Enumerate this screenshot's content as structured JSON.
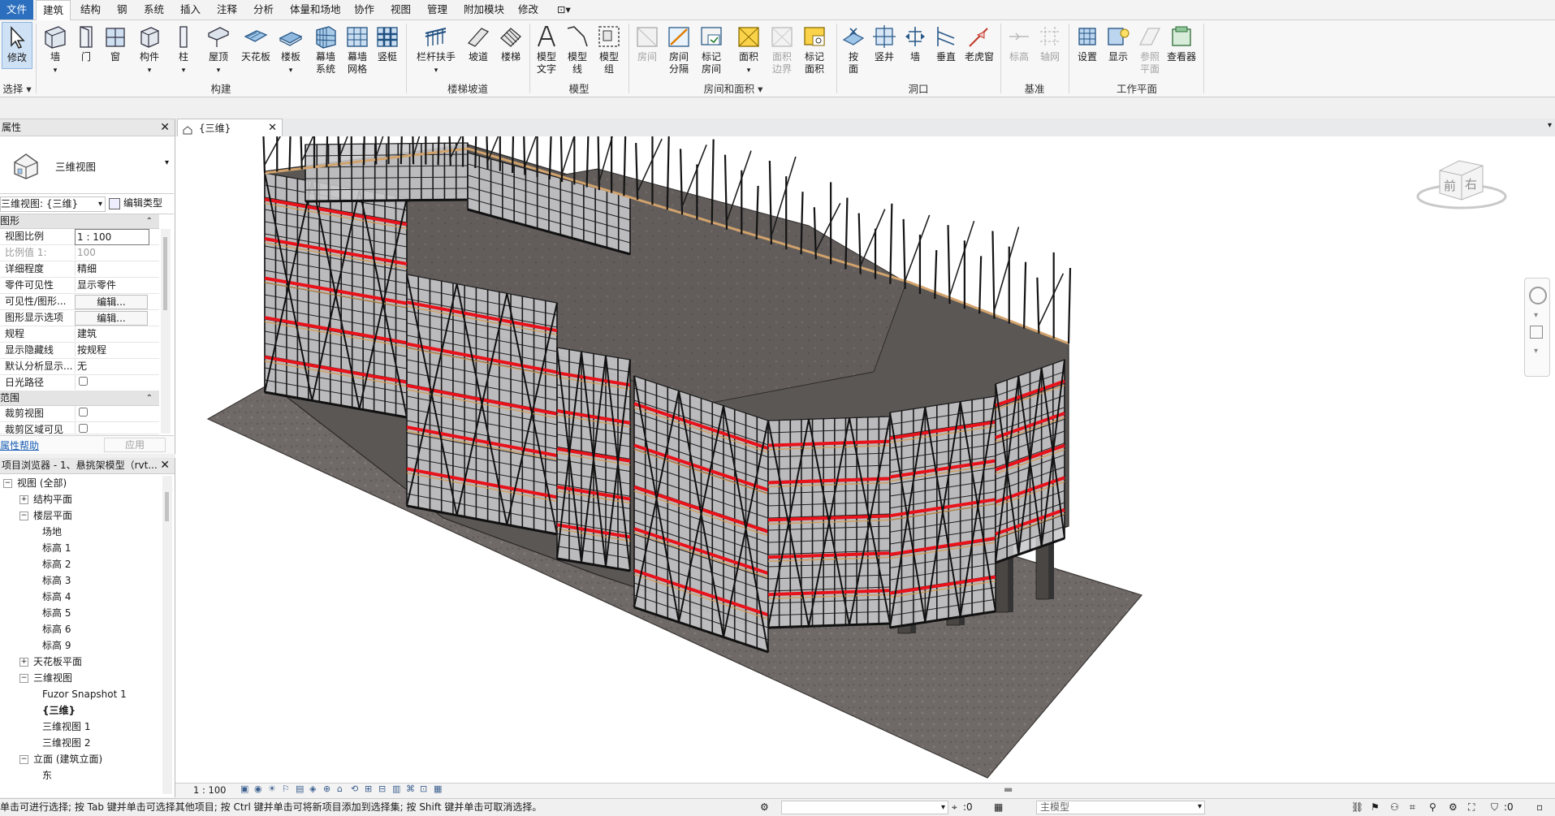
{
  "menubar": {
    "file": "文件",
    "tabs": [
      "建筑",
      "结构",
      "钢",
      "系统",
      "插入",
      "注释",
      "分析",
      "体量和场地",
      "协作",
      "视图",
      "管理",
      "附加模块",
      "修改"
    ],
    "active_tab": "建筑",
    "extra": "⊡▾"
  },
  "ribbon": {
    "buttons": {
      "modify": "修改",
      "wall": "墙",
      "door": "门",
      "window": "窗",
      "component": "构件",
      "column": "柱",
      "roof": "屋顶",
      "ceiling": "天花板",
      "floor": "楼板",
      "curtain_system_1": "幕墙",
      "curtain_system_2": "系统",
      "curtain_grid_1": "幕墙",
      "curtain_grid_2": "网格",
      "mullion": "竖梃",
      "railing": "栏杆扶手",
      "ramp": "坡道",
      "stair": "楼梯",
      "model_text_1": "模型",
      "model_text_2": "文字",
      "model_line_1": "模型",
      "model_line_2": "线",
      "model_group_1": "模型",
      "model_group_2": "组",
      "room": "房间",
      "room_sep_1": "房间",
      "room_sep_2": "分隔",
      "tag_room_1": "标记",
      "tag_room_2": "房间",
      "area": "面积",
      "area_boundary_1": "面积",
      "area_boundary_2": "边界",
      "tag_area_1": "标记",
      "tag_area_2": "面积",
      "by_face_1": "按",
      "by_face_2": "面",
      "shaft": "竖井",
      "wall_opening": "墙",
      "vertical": "垂直",
      "dormer": "老虎窗",
      "level": "标高",
      "grid": "轴网",
      "set": "设置",
      "show": "显示",
      "ref_plane_1": "参照",
      "ref_plane_2": "平面",
      "viewer": "查看器"
    },
    "groups": {
      "select": "选择 ▾",
      "build": "构建",
      "circulation": "楼梯坡道",
      "model": "模型",
      "room_area": "房间和面积 ▾",
      "opening": "洞口",
      "datum": "基准",
      "workplane": "工作平面"
    }
  },
  "properties": {
    "title": "属性",
    "type_name": "三维视图",
    "view_selector": "三维视图: {三维}",
    "edit_type": "编辑类型",
    "section_graphics": "图形",
    "rows": [
      {
        "k": "视图比例",
        "v": "1 : 100"
      },
      {
        "k": "比例值 1:",
        "v": "100"
      },
      {
        "k": "详细程度",
        "v": "精细"
      },
      {
        "k": "零件可见性",
        "v": "显示零件"
      },
      {
        "k": "可见性/图形...",
        "v": "编辑..."
      },
      {
        "k": "图形显示选项",
        "v": "编辑..."
      },
      {
        "k": "规程",
        "v": "建筑"
      },
      {
        "k": "显示隐藏线",
        "v": "按规程"
      },
      {
        "k": "默认分析显示...",
        "v": "无"
      },
      {
        "k": "日光路径",
        "v": ""
      }
    ],
    "section_extents": "范围",
    "extent_rows": [
      {
        "k": "裁剪视图",
        "v": ""
      },
      {
        "k": "裁剪区域可见",
        "v": ""
      }
    ],
    "help": "属性帮助",
    "apply": "应用"
  },
  "browser": {
    "title": "项目浏览器 - 1、悬挑架模型（rvt...",
    "items": [
      {
        "t": "视图 (全部)",
        "lvl": 0,
        "tog": "−"
      },
      {
        "t": "结构平面",
        "lvl": 1,
        "tog": "+"
      },
      {
        "t": "楼层平面",
        "lvl": 1,
        "tog": "−"
      },
      {
        "t": "场地",
        "lvl": 2,
        "tog": ""
      },
      {
        "t": "标高 1",
        "lvl": 2,
        "tog": ""
      },
      {
        "t": "标高 2",
        "lvl": 2,
        "tog": ""
      },
      {
        "t": "标高 3",
        "lvl": 2,
        "tog": ""
      },
      {
        "t": "标高 4",
        "lvl": 2,
        "tog": ""
      },
      {
        "t": "标高 5",
        "lvl": 2,
        "tog": ""
      },
      {
        "t": "标高 6",
        "lvl": 2,
        "tog": ""
      },
      {
        "t": "标高 9",
        "lvl": 2,
        "tog": ""
      },
      {
        "t": "天花板平面",
        "lvl": 1,
        "tog": "+"
      },
      {
        "t": "三维视图",
        "lvl": 1,
        "tog": "−"
      },
      {
        "t": "Fuzor Snapshot 1",
        "lvl": 2,
        "tog": ""
      },
      {
        "t": "{三维}",
        "lvl": 2,
        "tog": ""
      },
      {
        "t": "三维视图 1",
        "lvl": 2,
        "tog": ""
      },
      {
        "t": "三维视图 2",
        "lvl": 2,
        "tog": ""
      },
      {
        "t": "立面 (建筑立面)",
        "lvl": 1,
        "tog": "−"
      },
      {
        "t": "东",
        "lvl": 2,
        "tog": ""
      }
    ]
  },
  "tab": {
    "label": "{三维}"
  },
  "viewcube": {
    "front": "前",
    "right": "右"
  },
  "viewbar": {
    "scale": "1 : 100"
  },
  "status": {
    "message": "单击可进行选择; 按 Tab 键并单击可选择其他项目; 按 Ctrl 键并单击可将新项目添加到选择集; 按 Shift 键并单击可取消选择。",
    "count": ":0",
    "model": "主模型",
    "filter": ":0"
  },
  "colors": {
    "accent": "#2c6fbe",
    "red_band": "#e8121a",
    "timber": "#d59a4a"
  }
}
